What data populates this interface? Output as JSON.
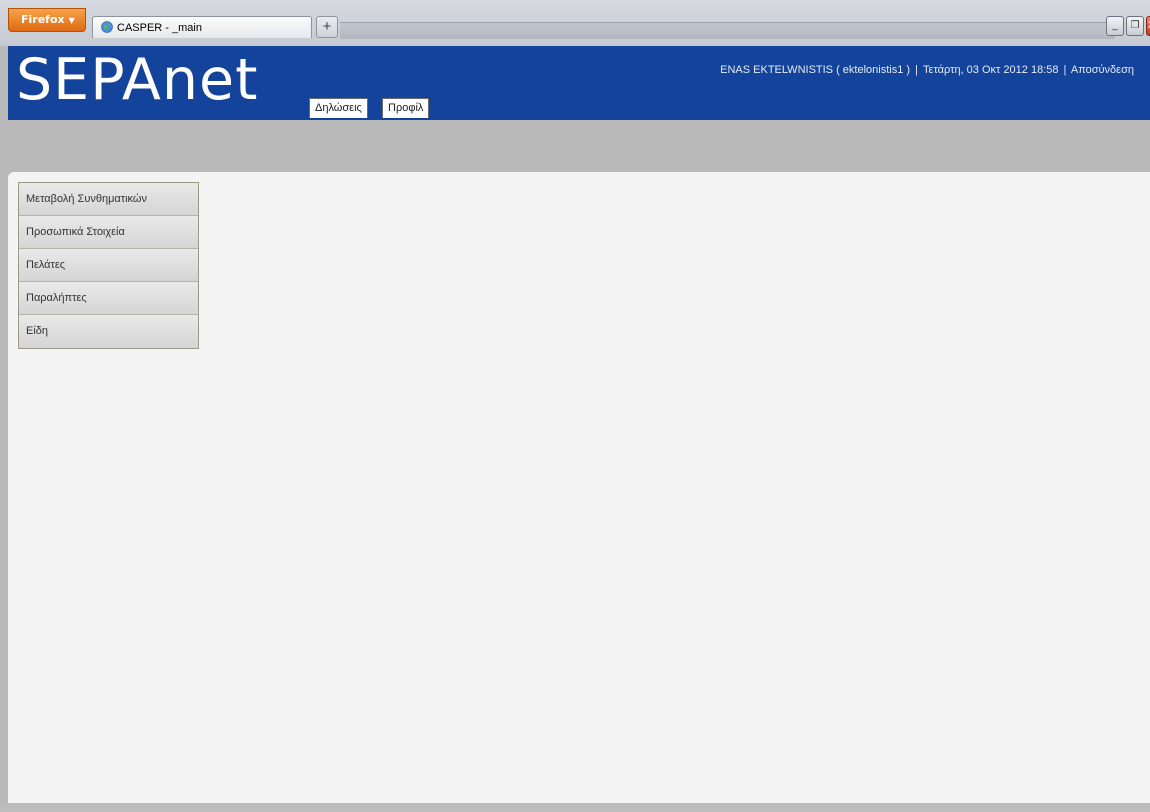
{
  "browser": {
    "menu_label": "Firefox",
    "tab_title": "CASPER - _main",
    "new_tab_label": "+",
    "minimize_label": "_",
    "restore_label": "❐",
    "close_label": "X"
  },
  "header": {
    "logo": "SEPAnet",
    "nav": [
      {
        "label": "Δηλώσεις"
      },
      {
        "label": "Προφίλ"
      }
    ],
    "user_line": {
      "user": "ENAS EKTELWNISTIS ( ektelonistis1 )",
      "separator": "|",
      "datetime": "Τετάρτη, 03 Οκτ 2012 18:58",
      "logout": "Αποσύνδεση"
    }
  },
  "sidebar": {
    "items": [
      {
        "label": "Μεταβολή Συνθηματικών"
      },
      {
        "label": "Προσωπικά Στοιχεία"
      },
      {
        "label": "Πελάτες"
      },
      {
        "label": "Παραλήπτες"
      },
      {
        "label": "Είδη"
      }
    ]
  },
  "colors": {
    "header_bg": "#13439b",
    "page_bg": "#b9b9b9",
    "content_bg": "#f4f4f4",
    "firefox_orange": "#e06a12"
  }
}
